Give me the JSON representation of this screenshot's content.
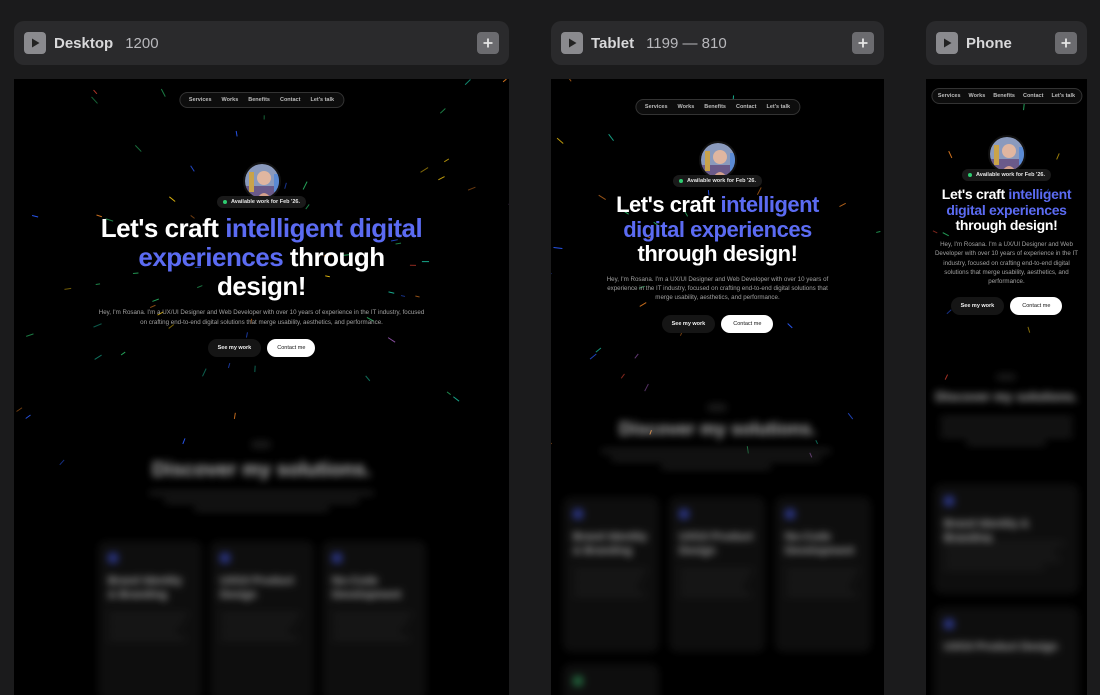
{
  "breakpoints": [
    {
      "id": "desktop",
      "name": "Desktop",
      "size": "1200"
    },
    {
      "id": "tablet",
      "name": "Tablet",
      "size": "1199 — 810"
    },
    {
      "id": "phone",
      "name": "Phone",
      "size": ""
    }
  ],
  "site": {
    "nav": [
      "Services",
      "Works",
      "Benefits",
      "Contact",
      "Let's talk"
    ],
    "badge": "Available work for Feb '26.",
    "headline": {
      "pre": "Let's craft ",
      "accent": "intelligent digital experiences",
      "post": " through design!"
    },
    "intro": "Hey, I'm Rosana. I'm a UX/UI Designer and Web Developer with over 10 years of experience in the IT industry, focused on crafting end-to-end digital solutions that merge usability, aesthetics, and performance.",
    "cta_primary": "See my work",
    "cta_secondary": "Contact me",
    "section_title": "Discover my solutions.",
    "cards": [
      "Brand Identity & Branding",
      "UX/UI Product Design",
      "No-Code Development"
    ]
  },
  "colors": {
    "accent": "#5b6bf2",
    "status_dot": "#2ecc71",
    "frame_bg": "#000000",
    "canvas_bg": "#1b1b1c"
  }
}
